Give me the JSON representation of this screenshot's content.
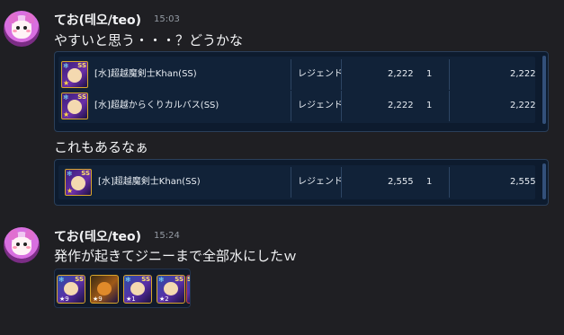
{
  "messages": [
    {
      "author": "てお(테오/teo)",
      "timestamp": "15:03",
      "lines": [
        "やすいと思う・・・？どうかな",
        "これもあるなぁ"
      ]
    },
    {
      "author": "てお(테오/teo)",
      "timestamp": "15:24",
      "lines": [
        "発作が起きてジニーまで全部水にしたｗ"
      ]
    }
  ],
  "table1": {
    "rows": [
      {
        "name": "[水]超越魔剣士Khan(SS)",
        "rarity": "レジェンド",
        "price": "2,222",
        "qty": "1",
        "total": "2,222"
      },
      {
        "name": "[水]超越からくりカルバス(SS)",
        "rarity": "レジェンド",
        "price": "2,222",
        "qty": "1",
        "total": "2,222"
      }
    ]
  },
  "table2": {
    "rows": [
      {
        "name": "[水]超越魔剣士Khan(SS)",
        "rarity": "レジェンド",
        "price": "2,555",
        "qty": "1",
        "total": "2,555"
      }
    ]
  },
  "icons_row": [
    {
      "grade": "SS",
      "level": "★9"
    },
    {
      "grade": "",
      "level": "★9"
    },
    {
      "grade": "SS",
      "level": "★1"
    },
    {
      "grade": "SS",
      "level": "★2"
    },
    {
      "grade": "SS",
      "level": ""
    }
  ],
  "colors": {
    "background": "#1f1f23",
    "panel": "#0d1b2e",
    "text": "#f2f3f5",
    "muted": "#949ba4"
  }
}
